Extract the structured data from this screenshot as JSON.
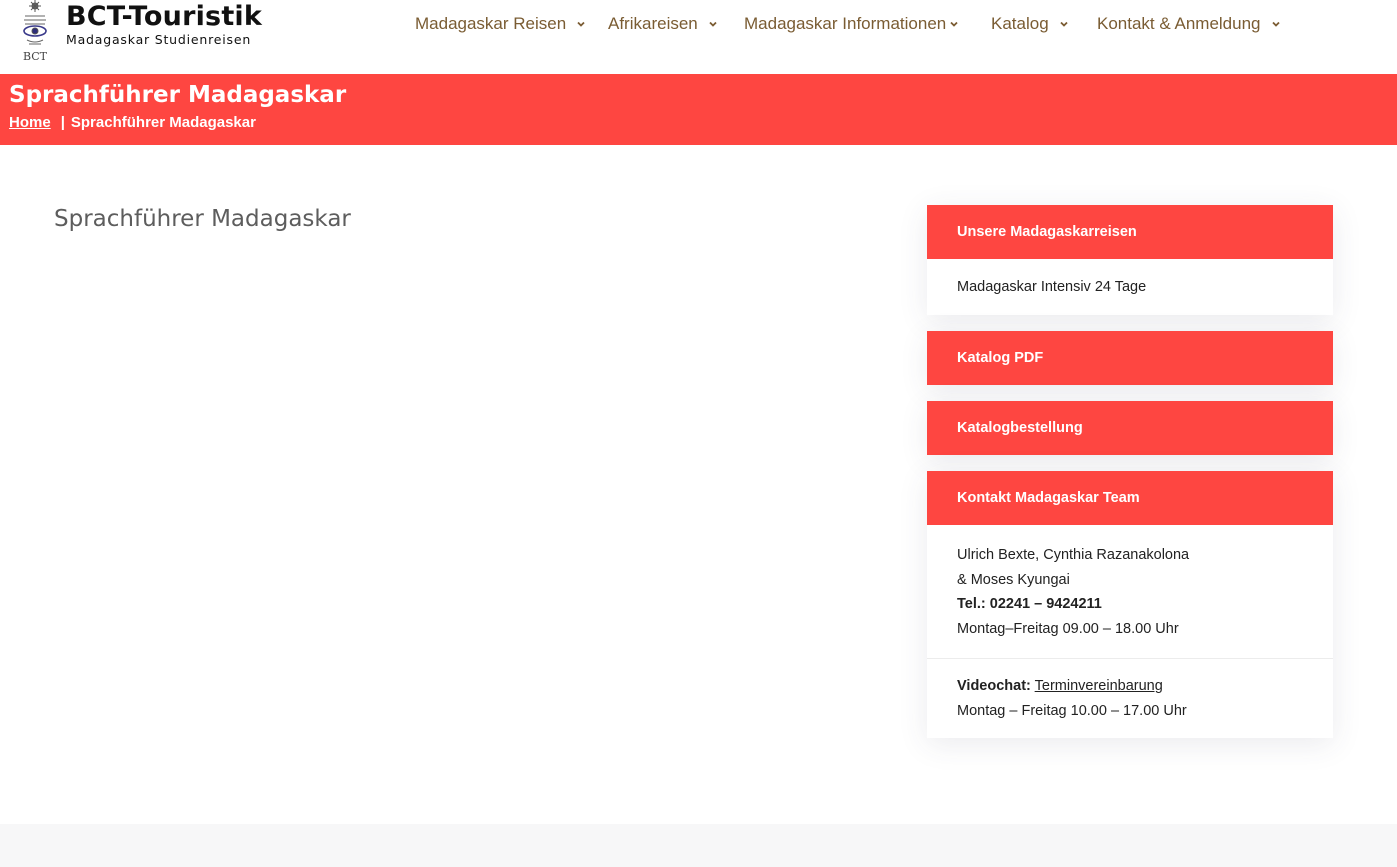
{
  "brand": {
    "name": "BCT-Touristik",
    "tagline": "Madagaskar Studienreisen",
    "logo_text": "BCT"
  },
  "nav": {
    "items": [
      {
        "label": "Madagaskar Reisen"
      },
      {
        "label": "Afrikareisen"
      },
      {
        "label": "Madagaskar Informationen"
      },
      {
        "label": "Katalog"
      },
      {
        "label": "Kontakt & Anmeldung"
      }
    ]
  },
  "title_band": {
    "title": "Sprachführer Madagaskar",
    "breadcrumb_home": "Home",
    "breadcrumb_sep": "|",
    "breadcrumb_current": "Sprachführer Madagaskar"
  },
  "main": {
    "heading": "Sprachführer Madagaskar"
  },
  "sidebar": {
    "tours_heading": "Unsere Madagaskarreisen",
    "tour_link": "Madagaskar Intensiv 24 Tage",
    "catalog_pdf": "Katalog PDF",
    "catalog_order": "Katalogbestellung",
    "contact_heading": "Kontakt Madagaskar Team",
    "contact_names_1": "Ulrich Bexte, Cynthia Razanakolona",
    "contact_names_2": "& Moses Kyungai",
    "contact_phone": "Tel.: 02241 – 9424211",
    "contact_hours": "Montag–Freitag 09.00 – 18.00 Uhr",
    "videochat_label": "Videochat:",
    "videochat_link": "Terminvereinbarung",
    "videochat_hours": "Montag – Freitag 10.00 – 17.00 Uhr"
  },
  "colors": {
    "accent": "#fe4641",
    "nav_text": "#7a5c33",
    "heading_text": "#5d5d5d"
  }
}
